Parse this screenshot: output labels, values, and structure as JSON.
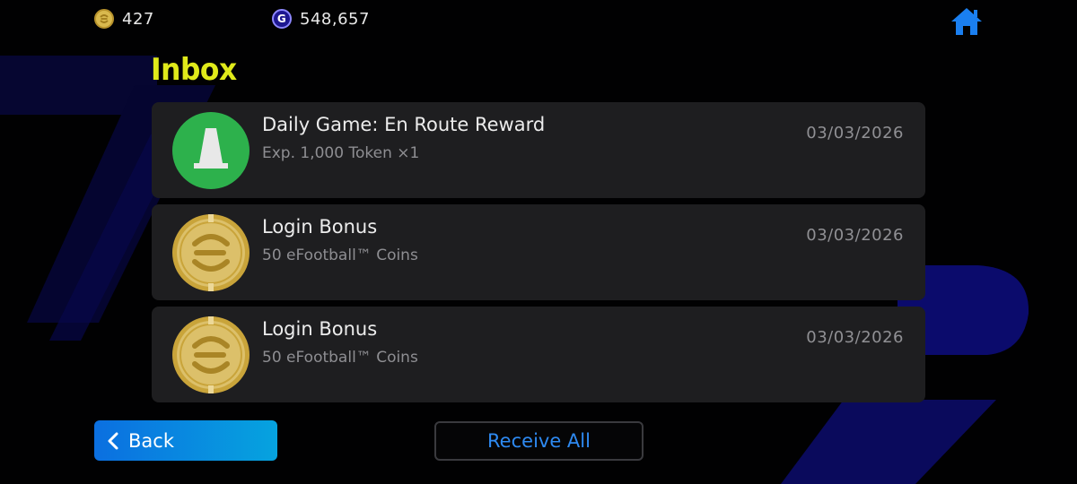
{
  "topbar": {
    "coins_value": "427",
    "gp_value": "548,657",
    "gp_symbol": "G",
    "coin_icon": "efootball-coin-icon",
    "gp_icon": "gp-icon",
    "home_icon": "home-icon"
  },
  "page": {
    "title": "Inbox"
  },
  "messages": [
    {
      "title": "Daily Game: En Route Reward",
      "subtitle": "Exp. 1,000 Token ×1",
      "date": "03/03/2026",
      "icon": "cone-icon"
    },
    {
      "title": "Login Bonus",
      "subtitle": "50 eFootball™ Coins",
      "date": "03/03/2026",
      "icon": "efootball-coin-icon"
    },
    {
      "title": "Login Bonus",
      "subtitle": "50 eFootball™ Coins",
      "date": "03/03/2026",
      "icon": "efootball-coin-icon"
    }
  ],
  "footer": {
    "back_label": "Back",
    "receive_all_label": "Receive All"
  },
  "colors": {
    "title": "#e0ea1a",
    "accent_blue": "#1576ea",
    "card_bg": "#1e1e20",
    "cone_bg": "#2db14c",
    "coin_gold": "#d9b94e"
  }
}
